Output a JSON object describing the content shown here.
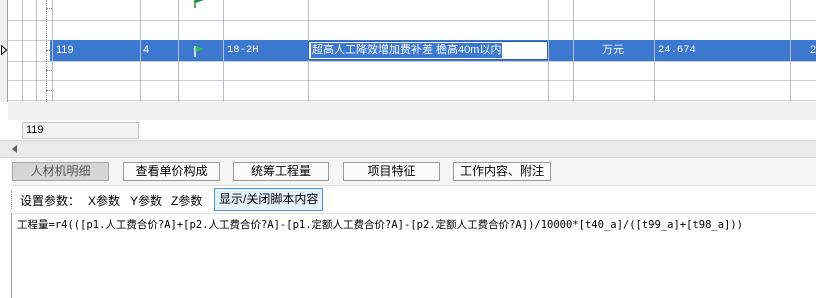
{
  "grid": {
    "selected_row": {
      "id": "119",
      "level": "4",
      "flag_icon": "green-flag-icon",
      "code": "18-2H",
      "name": "超高人工降效增加费补差 檐高40m以内",
      "unit": "万元",
      "quantity": "24.674",
      "last_col_partial": "2"
    },
    "selection_color": "#3c77d0",
    "flag_color": "#1e8f3c"
  },
  "code_box": {
    "value": "119"
  },
  "tabs": [
    {
      "label": "人材机明细",
      "active": true
    },
    {
      "label": "查看单价构成",
      "active": false
    },
    {
      "label": "统筹工程量",
      "active": false
    },
    {
      "label": "项目特征",
      "active": false
    },
    {
      "label": "工作内容、附注",
      "active": false
    }
  ],
  "params": {
    "label": "设置参数：",
    "x_label": "X参数",
    "y_label": "Y参数",
    "z_label": "Z参数",
    "toggle_label": "显示/关闭脚本内容"
  },
  "editor": {
    "formula": "工程量=r4(([p1.人工费合价?A]+[p2.人工费合价?A]-[p1.定额人工费合价?A]-[p2.定额人工费合价?A])/10000*[t40_a]/([t99_a]+[t98_a]))"
  }
}
